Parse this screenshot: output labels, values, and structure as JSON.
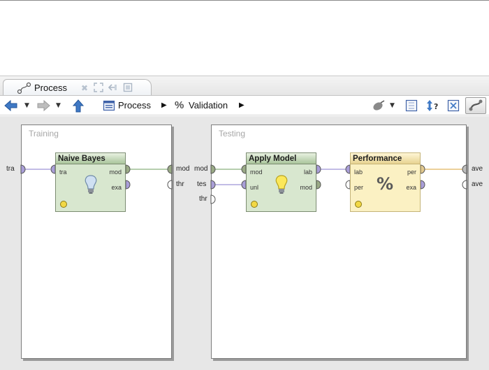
{
  "tab": {
    "label": "Process"
  },
  "toolbar": {
    "breadcrumb": [
      {
        "label": "Process"
      },
      {
        "label": "Validation"
      }
    ]
  },
  "subprocesses": {
    "training": {
      "title": "Training"
    },
    "testing": {
      "title": "Testing"
    }
  },
  "outer_ports": {
    "training_in": "tra",
    "training_out_mod": "mod",
    "training_out_thr": "thr",
    "testing_in_mod": "mod",
    "testing_in_tes": "tes",
    "testing_in_thr": "thr",
    "testing_out_1": "ave",
    "testing_out_2": "ave"
  },
  "operators": {
    "naive_bayes": {
      "name": "Naive Bayes",
      "in": [
        "tra"
      ],
      "out": [
        "mod",
        "exa"
      ]
    },
    "apply_model": {
      "name": "Apply Model",
      "in": [
        "mod",
        "unl"
      ],
      "out": [
        "lab",
        "mod"
      ]
    },
    "performance": {
      "name": "Performance",
      "in": [
        "lab",
        "per"
      ],
      "out": [
        "per",
        "exa"
      ]
    }
  },
  "colors": {
    "learner_operator": "#d8e7cf",
    "performance_operator": "#fbf1c3",
    "port_model": "#9aaa86",
    "port_example": "#a99ed8",
    "port_performance": "#e2c98e",
    "wire_model": "#8ab17e",
    "wire_example": "#9d94d6",
    "wire_performance": "#e0b45e"
  },
  "icons": [
    "process-tab-icon",
    "back-arrow-icon",
    "forward-arrow-icon",
    "up-arrow-icon",
    "process-icon",
    "percent-icon",
    "wiring-icon",
    "fit-icon",
    "order-icon",
    "auto-layout-icon",
    "connection-icon",
    "lightbulb-icon"
  ]
}
